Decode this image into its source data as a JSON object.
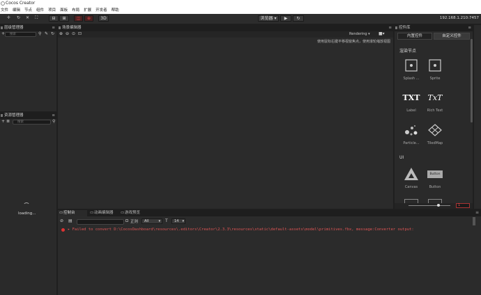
{
  "app": {
    "title": "Cocos Creator"
  },
  "menu": [
    "文件",
    "编辑",
    "节点",
    "组件",
    "项目",
    "面板",
    "布局",
    "扩展",
    "开发者",
    "帮助"
  ],
  "toolbar": {
    "preview_select": "浏览器",
    "ip": "192.168.1.210:7457",
    "mode_3d": "3D"
  },
  "hierarchy": {
    "title": "层级管理器",
    "search_placeholder": "搜索"
  },
  "assets": {
    "title": "资源管理器",
    "search_placeholder": "搜索",
    "loading": "loading..."
  },
  "scene": {
    "title": "场景编辑器",
    "rendering": "Rendering",
    "hint": "使用鼠标右键平移视窗焦点，使用滚轮缩放视图"
  },
  "widgets": {
    "title": "控件库",
    "tabs": [
      "内置控件",
      "自定义控件"
    ],
    "section_render": "渲染节点",
    "section_ui": "UI",
    "items": [
      {
        "label": "Splash ...",
        "icon": "splash-icon"
      },
      {
        "label": "Sprite",
        "icon": "sprite-icon"
      },
      {
        "label": "Label",
        "icon": "label-icon"
      },
      {
        "label": "Rich Text",
        "icon": "richtext-icon"
      },
      {
        "label": "Particle...",
        "icon": "particle-icon"
      },
      {
        "label": "TiledMap",
        "icon": "tiledmap-icon"
      },
      {
        "label": "Canvas",
        "icon": "canvas-icon"
      },
      {
        "label": "Button",
        "icon": "button-icon"
      }
    ],
    "icon_text_label": "TXT",
    "icon_text_rich": "TxT",
    "button_sample": "Button",
    "zoom_value": "1"
  },
  "console": {
    "tabs": [
      "控制台",
      "动画编辑器",
      "游戏预览"
    ],
    "filter_label": "正则",
    "level": "All",
    "font_size": "14",
    "message": "Failed to convert D:\\CocosDashboard\\resources\\.editors\\Creator\\2.3.3\\resources\\static\\default-assets\\model\\primitives.fbx, message:Converter output:"
  }
}
